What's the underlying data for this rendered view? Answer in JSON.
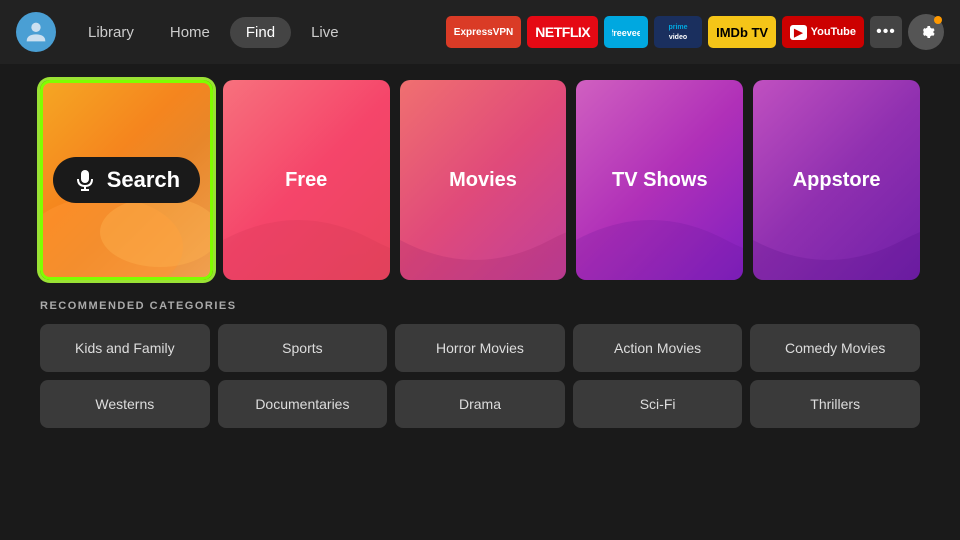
{
  "header": {
    "nav": [
      {
        "label": "Library",
        "active": false
      },
      {
        "label": "Home",
        "active": false
      },
      {
        "label": "Find",
        "active": true
      },
      {
        "label": "Live",
        "active": false
      }
    ],
    "apps": [
      {
        "label": "ExpressVPN",
        "class": "badge-expressvpn"
      },
      {
        "label": "NETFLIX",
        "class": "badge-netflix"
      },
      {
        "label": "freevee",
        "class": "badge-freevee"
      },
      {
        "label": "prime video",
        "class": "badge-prime"
      },
      {
        "label": "IMDb TV",
        "class": "badge-imdb"
      },
      {
        "label": "▶ YouTube",
        "class": "badge-youtube"
      }
    ],
    "more_label": "•••",
    "settings_label": "⚙"
  },
  "tiles": [
    {
      "id": "search",
      "label": "Search",
      "class": "tile-search"
    },
    {
      "id": "free",
      "label": "Free",
      "class": "tile-free"
    },
    {
      "id": "movies",
      "label": "Movies",
      "class": "tile-movies"
    },
    {
      "id": "tvshows",
      "label": "TV Shows",
      "class": "tile-tvshows"
    },
    {
      "id": "appstore",
      "label": "Appstore",
      "class": "tile-appstore"
    }
  ],
  "categories_section": {
    "title": "RECOMMENDED CATEGORIES",
    "items": [
      "Kids and Family",
      "Sports",
      "Horror Movies",
      "Action Movies",
      "Comedy Movies",
      "Westerns",
      "Documentaries",
      "Drama",
      "Sci-Fi",
      "Thrillers"
    ]
  }
}
